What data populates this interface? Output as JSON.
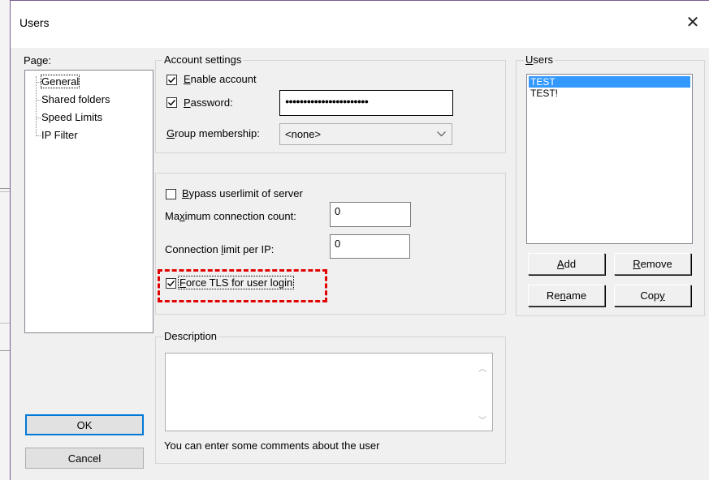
{
  "window": {
    "title": "Users",
    "close_symbol": "✕"
  },
  "page_panel": {
    "label": "Page:",
    "items": [
      "General",
      "Shared folders",
      "Speed Limits",
      "IP Filter"
    ],
    "selected": "General"
  },
  "account_settings": {
    "group_title": "Account settings",
    "enable_account": {
      "pre": "",
      "key": "E",
      "post": "nable account",
      "checked": true
    },
    "password": {
      "pre": "",
      "key": "P",
      "post": "assword:",
      "checked": true,
      "value": "●●●●●●●●●●●●●●●●●●●●●●●"
    },
    "group_membership": {
      "pre": "",
      "key": "G",
      "post": "roup membership:",
      "value": "<none>"
    }
  },
  "limits": {
    "bypass": {
      "pre": "",
      "key": "B",
      "post": "ypass userlimit of server",
      "checked": false
    },
    "max_conn": {
      "pre": "Ma",
      "key": "x",
      "post": "imum connection count:",
      "value": "0"
    },
    "conn_per_ip": {
      "pre": "Connection ",
      "key": "l",
      "post": "imit per IP:",
      "value": "0"
    },
    "force_tls": {
      "pre": "",
      "key": "F",
      "post": "orce TLS for user login",
      "checked": true
    },
    "highlight_color": "#e00000"
  },
  "description": {
    "group_title": "Description",
    "hint": "You can enter some comments about the user"
  },
  "users_panel": {
    "group_title": {
      "pre": "",
      "key": "U",
      "post": "sers"
    },
    "users": [
      "TEST",
      "TEST!"
    ],
    "selected_index": 0,
    "add": {
      "pre": "",
      "key": "A",
      "post": "dd"
    },
    "remove": {
      "pre": "",
      "key": "R",
      "post": "emove"
    },
    "rename": {
      "pre": "Re",
      "key": "n",
      "post": "ame"
    },
    "copy": {
      "pre": "Cop",
      "key": "y",
      "post": ""
    }
  },
  "buttons": {
    "ok": "OK",
    "cancel": "Cancel"
  },
  "colors": {
    "selection": "#3399ff",
    "default_button_border": "#0078d7"
  }
}
